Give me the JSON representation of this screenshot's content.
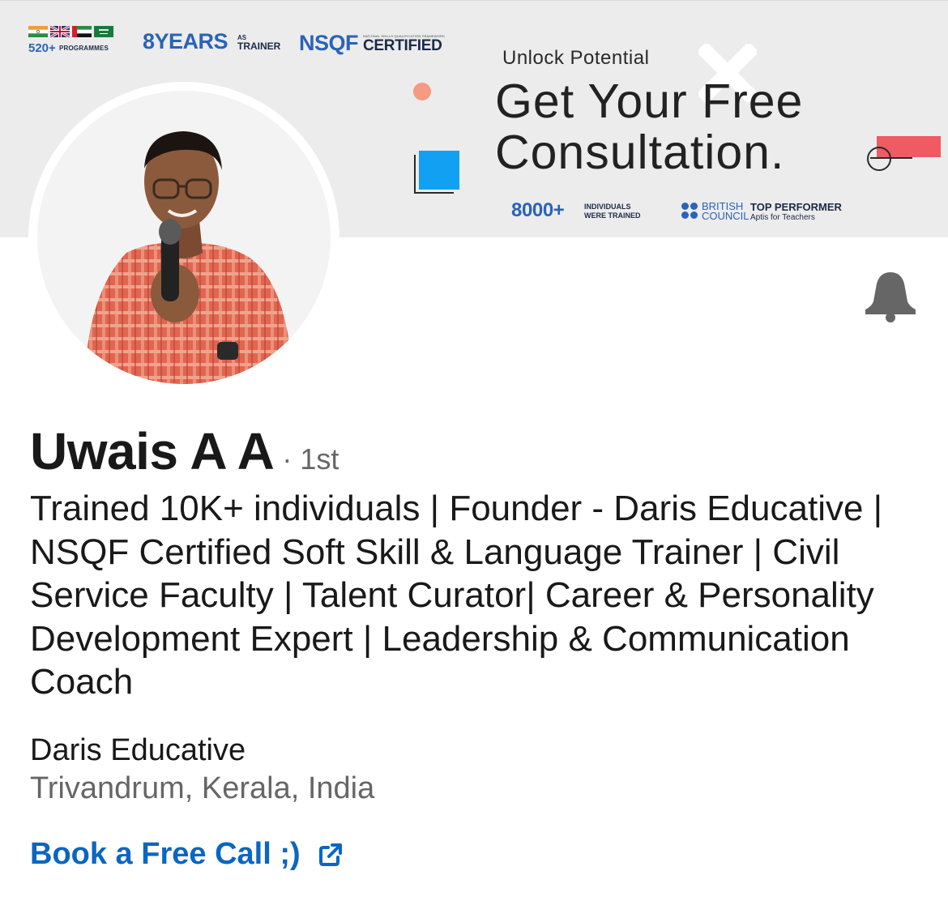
{
  "banner": {
    "programmes_count": "520+",
    "programmes_label": "PROGRAMMES",
    "years": "8YEARS",
    "years_as": "AS",
    "years_trainer": "TRAINER",
    "nsqf": "NSQF",
    "nsqf_tiny": "NATIONAL SKILLS QUALIFICATION FRAMEWORK",
    "nsqf_certified": "CERTIFIED",
    "unlock": "Unlock Potential",
    "headline_line1": "Get Your Free",
    "headline_line2": "Consultation.",
    "trained_count": "8000+",
    "trained_line1": "INDIVIDUALS",
    "trained_line2": "WERE TRAINED",
    "british_council_1": "BRITISH",
    "british_council_2": "COUNCIL",
    "top_performer": "TOP PERFORMER",
    "aptis": "Aptis for Teachers",
    "colors": {
      "brand_blue": "#2a63b8",
      "accent_blue": "#12a1f2",
      "accent_red": "#ef5a63",
      "accent_orange": "#f59a83"
    },
    "flags": [
      "india-flag-icon",
      "uk-flag-icon",
      "uae-flag-icon",
      "saudi-flag-icon"
    ]
  },
  "profile": {
    "name": "Uwais A A",
    "degree": "· 1st",
    "headline": "Trained 10K+ individuals | Founder - Daris Educative | NSQF Certified Soft Skill & Language Trainer | Civil Service Faculty | Talent Curator| Career & Personality Development Expert | Leadership & Communication Coach",
    "company": "Daris Educative",
    "location": "Trivandrum, Kerala, India",
    "link_label": "Book a Free Call ;)",
    "link_color": "#0a66c2"
  },
  "icons": {
    "notification": "bell-icon",
    "external_link": "external-link-icon"
  }
}
